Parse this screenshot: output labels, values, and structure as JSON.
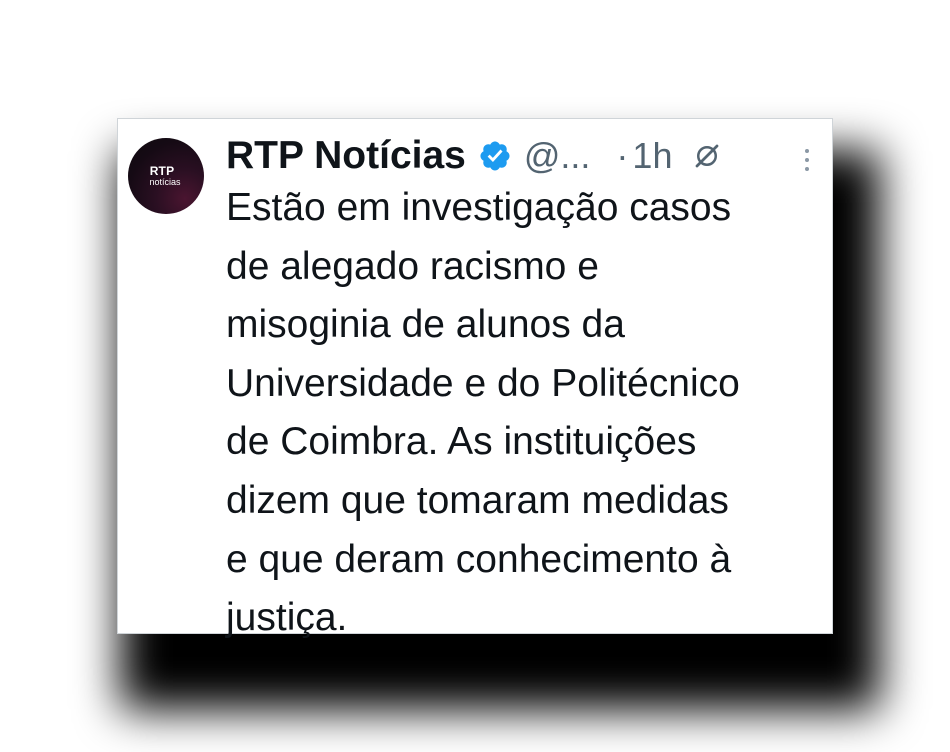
{
  "tweet": {
    "avatar_text_top": "RTP",
    "avatar_text_bottom": "notícias",
    "display_name": "RTP Notícias",
    "handle": "@...",
    "separator": "·",
    "time": "1h",
    "verified_icon": "verified-badge-icon",
    "grok_icon": "grok-icon",
    "more_icon": "more-options-icon",
    "text": "Estão em investigação casos\nde alegado racismo e\nmisoginia de alunos da\nUniversidade e do Politécnico\nde Coimbra. As instituições\ndizem que tomaram medidas\ne que deram conhecimento à\njustiça."
  },
  "colors": {
    "text_primary": "#0f1419",
    "text_secondary": "#536471",
    "verified_blue": "#1d9bf0",
    "background": "#ffffff"
  }
}
